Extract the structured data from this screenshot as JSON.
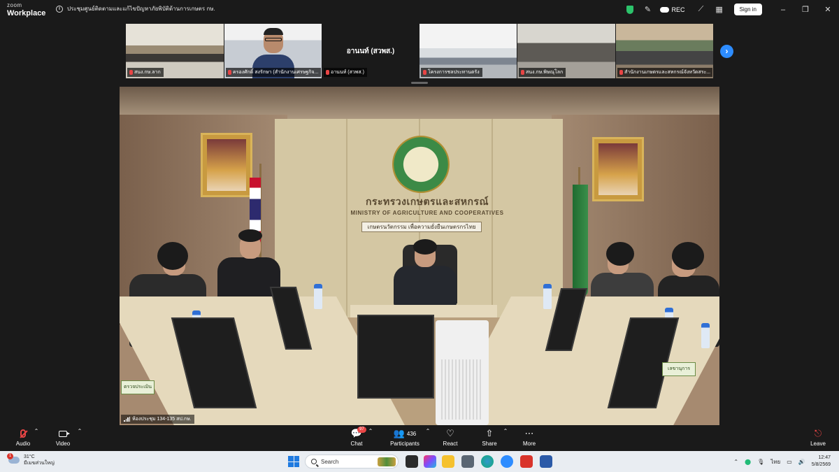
{
  "app": {
    "brand_top": "zoom",
    "brand_bottom": "Workplace",
    "meeting_title": "ประชุมศูนย์ติดตามและแก้ไขปัญหาภัยพิบัติด้านการเกษตร กษ."
  },
  "titlebar": {
    "rec_label": "REC",
    "signin_label": "Sign in",
    "minimize": "–",
    "restore": "❐",
    "close": "✕"
  },
  "gallery": {
    "tiles": [
      {
        "name": "สนง.กษ.ลาก",
        "muted": true
      },
      {
        "name": "ครองศักดิ์ สงรักษา (สำนักงานเศรษฐกิจ...",
        "muted": true
      },
      {
        "name": "อานนท์ (สวพส.)",
        "muted": true,
        "big_label": "อานนท์ (สวพส.)"
      },
      {
        "name": "โครงการชลประทานตรัง",
        "muted": true
      },
      {
        "name": "สนง.กษ.พิษณุโลก",
        "muted": true
      },
      {
        "name": "สำนักงานเกษตรและสหกรณ์จังหวัดสระ...",
        "muted": true
      }
    ],
    "next_icon": "chevron-right-icon"
  },
  "main_video": {
    "ministry_th": "กระทรวงเกษตรและสหกรณ์",
    "ministry_en": "MINISTRY OF AGRICULTURE AND COOPERATIVES",
    "slogan": "เกษตรนวัตกรรม เพื่อความยั่งยืนเกษตรกรไทย",
    "participant_label": "ห้องประชุม 134-135 สป.กษ.",
    "nameplate_left": "ตรวจประเมิน",
    "nameplate_right": "เลขานุการ"
  },
  "toolbar": {
    "audio_label": "Audio",
    "video_label": "Video",
    "chat_label": "Chat",
    "chat_badge": "97",
    "participants_label": "Participants",
    "participants_count": "436",
    "react_label": "React",
    "share_label": "Share",
    "more_label": "More",
    "leave_label": "Leave"
  },
  "taskbar": {
    "weather_temp": "31°C",
    "weather_desc": "มีเมฆส่วนใหญ่",
    "weather_badge": "1",
    "search_placeholder": "Search",
    "language": "ไทย",
    "time": "12:47",
    "date": "5/8/2569",
    "colors": {
      "accent": "#1f7ae0",
      "zoom_blue": "#2d8cff",
      "mute_red": "#e84545"
    }
  }
}
